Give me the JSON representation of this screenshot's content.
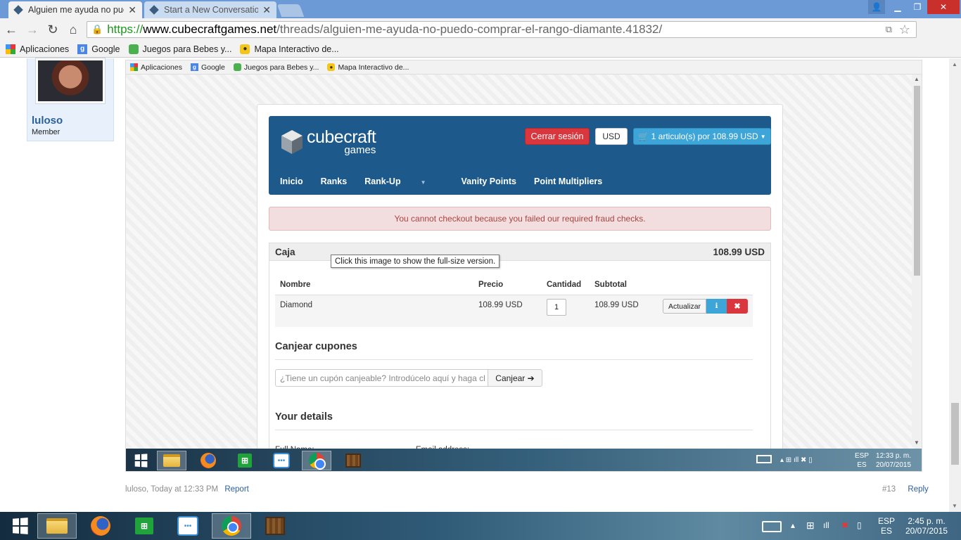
{
  "browser": {
    "tabs": [
      {
        "title": "Alguien me ayuda no pue",
        "active": true
      },
      {
        "title": "Start a New Conversation",
        "active": false
      }
    ],
    "url": {
      "scheme": "https://",
      "host": "www.cubecraftgames.net",
      "path": "/threads/alguien-me-ayuda-no-puedo-comprar-el-rango-diamante.41832/"
    },
    "bookmarks": [
      {
        "label": "Aplicaciones",
        "icon": "apps-icon"
      },
      {
        "label": "Google",
        "icon": "google-icon"
      },
      {
        "label": "Juegos para Bebes y...",
        "icon": "bebes-icon"
      },
      {
        "label": "Mapa Interactivo de...",
        "icon": "map-pin-icon"
      }
    ]
  },
  "forum": {
    "user": {
      "name": "luloso",
      "role": "Member"
    },
    "footer": {
      "meta": "luloso, Today at 12:33 PM",
      "report": "Report",
      "post_number": "#13",
      "reply": "Reply"
    }
  },
  "screenshot": {
    "inner_bookmarks": [
      {
        "label": "Aplicaciones"
      },
      {
        "label": "Google"
      },
      {
        "label": "Juegos para Bebes y..."
      },
      {
        "label": "Mapa Interactivo de..."
      }
    ],
    "store": {
      "logo_line1": "cubecraft",
      "logo_line2": "games",
      "logout": "Cerrar sesión",
      "currency": "USD",
      "cart": "1 articulo(s) por 108.99 USD",
      "menu": [
        "Inicio",
        "Ranks",
        "Rank-Up",
        "Vanity Points",
        "Point Multipliers"
      ]
    },
    "alert": "You cannot checkout because you failed our required fraud checks.",
    "checkout": {
      "title": "Caja",
      "total": "108.99 USD",
      "tooltip": "Click this image to show the full-size version.",
      "headers": {
        "name": "Nombre",
        "price": "Precio",
        "qty": "Cantidad",
        "subtotal": "Subtotal"
      },
      "item": {
        "name": "Diamond",
        "price": "108.99 USD",
        "qty": "1",
        "subtotal": "108.99 USD"
      },
      "update_button": "Actualizar"
    },
    "coupons": {
      "title": "Canjear cupones",
      "placeholder": "¿Tiene un cupón canjeable? Introdúcelo aquí y haga cl",
      "button": "Canjear"
    },
    "details": {
      "title": "Your details",
      "full_name": "Full Name:",
      "email": "Email address:"
    },
    "taskbar": {
      "lang1": "ESP",
      "lang2": "ES",
      "time": "12:33 p. m.",
      "date": "20/07/2015"
    }
  },
  "taskbar": {
    "lang1": "ESP",
    "lang2": "ES",
    "time": "2:45 p. m.",
    "date": "20/07/2015"
  }
}
